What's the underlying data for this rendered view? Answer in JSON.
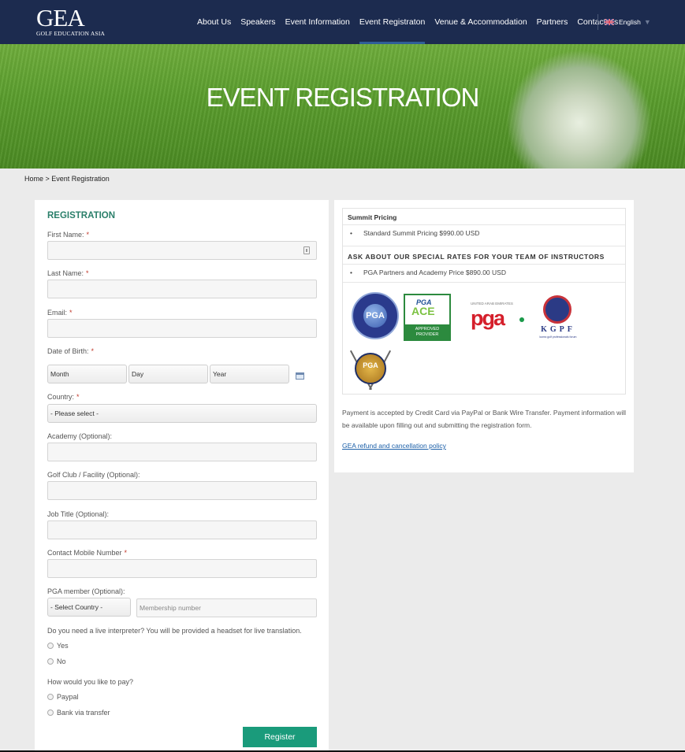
{
  "brand": {
    "name": "GEA",
    "tagline": "GOLF EDUCATION ASIA"
  },
  "nav": {
    "items": [
      "About Us",
      "Speakers",
      "Event Information",
      "Event Registraton",
      "Venue & Accommodation",
      "Partners",
      "Contact Us"
    ],
    "active": "Event Registraton",
    "language": "English"
  },
  "hero": {
    "title": "EVENT REGISTRATION"
  },
  "breadcrumb": "Home > Event Registration",
  "form": {
    "title": "REGISTRATION",
    "required_mark": "*",
    "first_name_label": "First Name:",
    "last_name_label": "Last Name:",
    "email_label": "Email:",
    "dob_label": "Date of Birth:",
    "dob_month": "Month",
    "dob_day": "Day",
    "dob_year": "Year",
    "country_label": "Country:",
    "country_value": "- Please select -",
    "academy_label": "Academy (Optional):",
    "golf_club_label": "Golf Club / Facility (Optional):",
    "job_title_label": "Job Title (Optional):",
    "mobile_label": "Contact Mobile Number",
    "pga_label": "PGA member (Optional):",
    "pga_country_value": "- Select Country -",
    "membership_placeholder": "Membership number",
    "interpreter_question": "Do you need a live interpreter? You will be provided a headset for live translation.",
    "interpreter_options": [
      "Yes",
      "No"
    ],
    "pay_question": "How would you like to pay?",
    "pay_options": [
      "Paypal",
      "Bank via transfer"
    ],
    "register_label": "Register"
  },
  "info": {
    "pricing_title": "Summit Pricing",
    "bullet": "•",
    "standard_price": "Standard Summit Pricing $990.00 USD",
    "special_rates_title": "ASK ABOUT OUR SPECIAL RATES FOR YOUR TEAM OF INSTRUCTORS",
    "partner_price": "PGA Partners and Academy Price $890.00 USD",
    "logos": {
      "pga_nz": "PGA",
      "ace_pga": "PGA",
      "ace_word": "ACE",
      "ace_line1": "APPROVED",
      "ace_line2": "PROVIDER",
      "uae_top": "UNITED ARAB EMIRATES",
      "uae_pga": "pga",
      "kgpf": "KGPF",
      "kgpf_sub": "korea golf professionals forum",
      "gold_pga": "PGA"
    },
    "payment_text": "Payment is accepted by Credit Card via PayPal or Bank Wire Transfer. Payment information will be available upon filling out and submitting the registration form.",
    "policy_link": "GEA refund and cancellation policy"
  },
  "colors": {
    "nav_bg": "#1c2b4f",
    "accent_green": "#1a9b7b",
    "title_green": "#2a7f6a",
    "required_red": "#c0392b",
    "link_blue": "#1b5fa8"
  }
}
